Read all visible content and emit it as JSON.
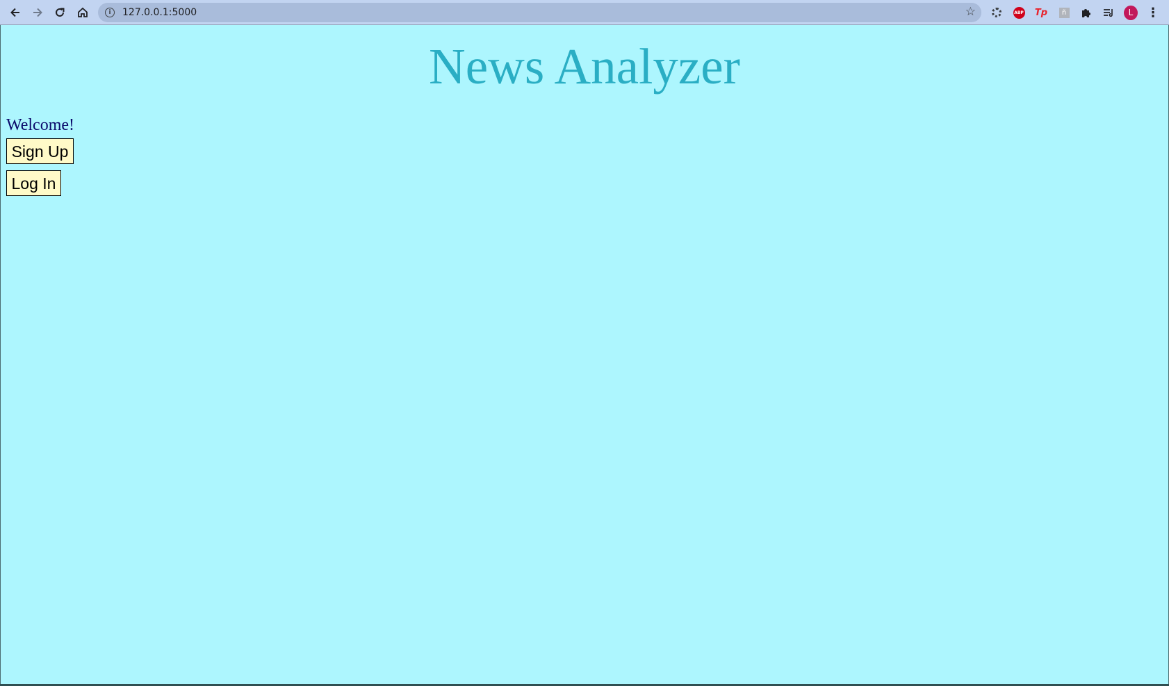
{
  "browser": {
    "url": "127.0.0.1:5000",
    "icons": {
      "back": "back-arrow-icon",
      "forward": "forward-arrow-icon",
      "reload": "reload-icon",
      "home": "home-icon",
      "info": "info-icon",
      "star": "bookmark-star-icon",
      "menu": "kebab-menu-icon"
    },
    "extensions": {
      "abp_label": "ABP",
      "tp_label": "Tp",
      "grey_label": "ñ"
    },
    "profile_initial": "L"
  },
  "page": {
    "title": "News Analyzer",
    "welcome_text": "Welcome!",
    "signup_label": "Sign Up",
    "login_label": "Log In"
  },
  "colors": {
    "background": "#adf6fe",
    "title": "#2aaec4",
    "welcome": "#0b0a6b",
    "button_bg": "#fffac8",
    "chrome_bg": "#c2d4f1",
    "avatar": "#c2185b"
  }
}
